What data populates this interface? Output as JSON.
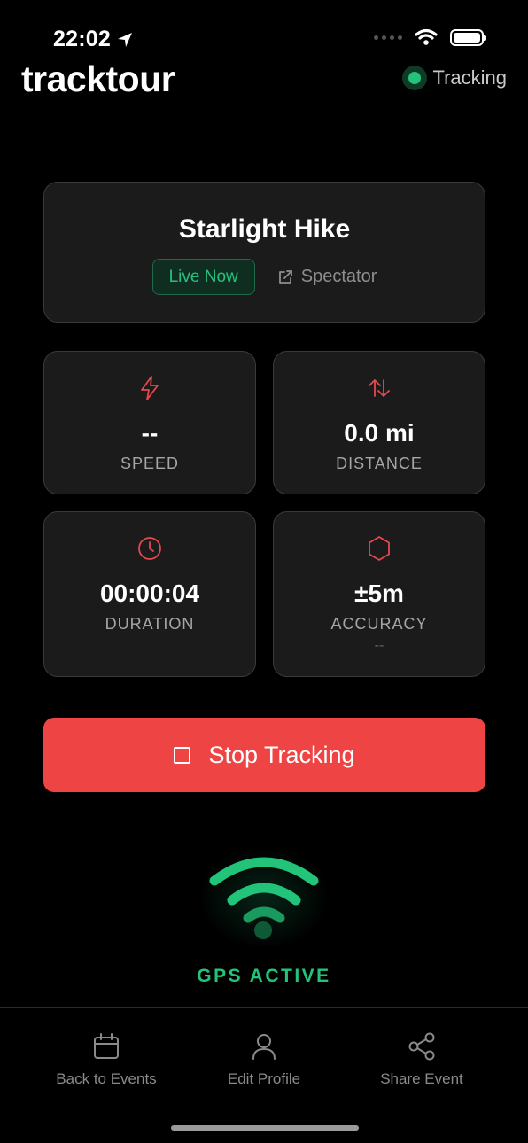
{
  "status_bar": {
    "time": "22:02"
  },
  "header": {
    "logo": "tracktour",
    "tracking_label": "Tracking"
  },
  "event": {
    "title": "Starlight Hike",
    "live_badge": "Live Now",
    "spectator_label": "Spectator"
  },
  "stats": [
    {
      "icon": "lightning-icon",
      "value": "--",
      "label": "SPEED"
    },
    {
      "icon": "arrows-swap-icon",
      "value": "0.0 mi",
      "label": "DISTANCE"
    },
    {
      "icon": "clock-icon",
      "value": "00:00:04",
      "label": "DURATION"
    },
    {
      "icon": "hexagon-icon",
      "value": "±5m",
      "label": "ACCURACY",
      "sub": "--"
    }
  ],
  "stop_button": {
    "label": "Stop Tracking"
  },
  "gps": {
    "label": "GPS ACTIVE"
  },
  "tabs": [
    {
      "icon": "calendar-icon",
      "label": "Back to Events"
    },
    {
      "icon": "user-icon",
      "label": "Edit Profile"
    },
    {
      "icon": "share-icon",
      "label": "Share Event"
    }
  ],
  "colors": {
    "accent_green": "#22c47a",
    "danger_red": "#ef4444",
    "icon_red": "#e5484d",
    "card_bg": "#1b1b1b"
  }
}
